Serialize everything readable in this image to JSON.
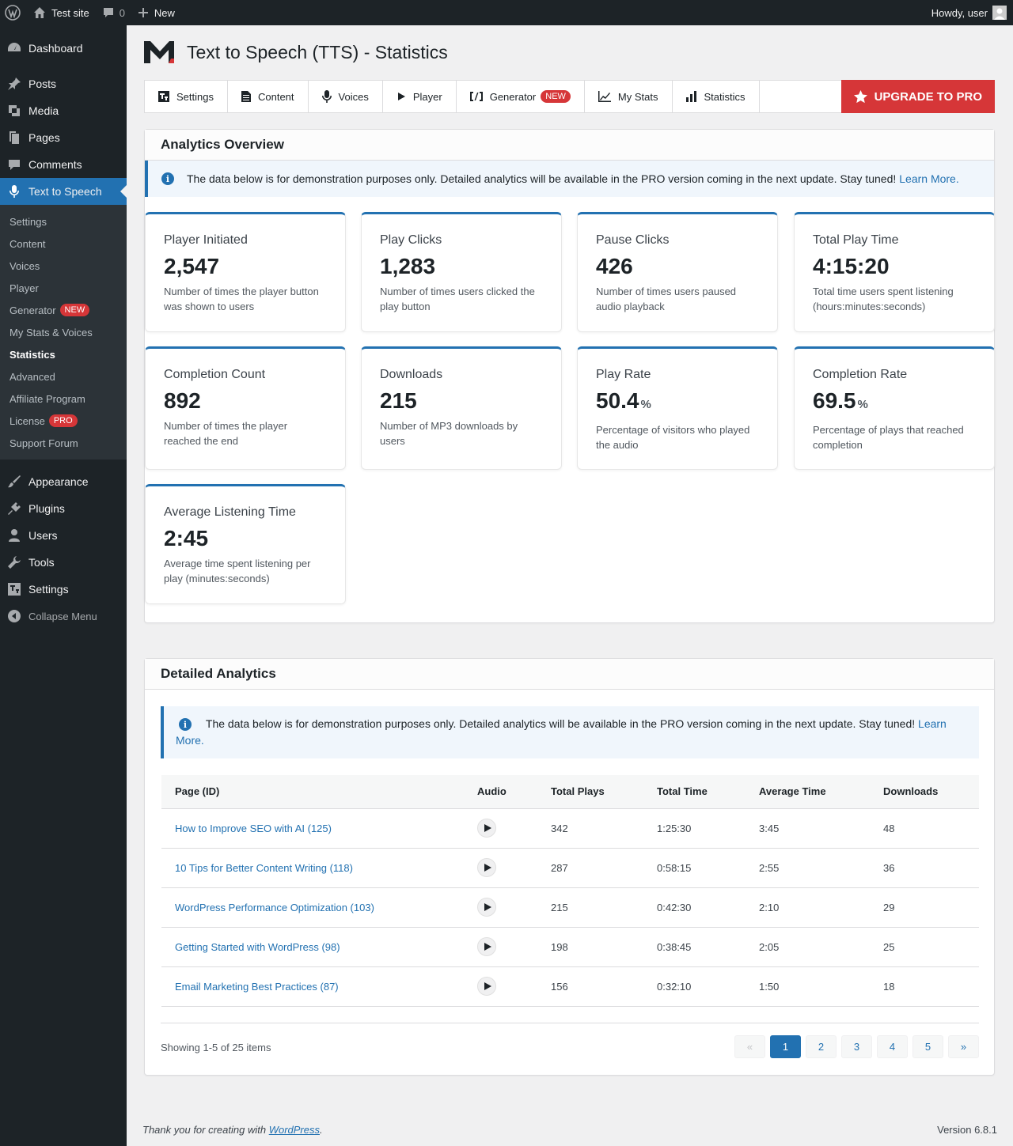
{
  "adminbar": {
    "site_name": "Test site",
    "comments_count": "0",
    "new_label": "New",
    "howdy": "Howdy, user"
  },
  "sidebar": {
    "items_top": [
      {
        "label": "Dashboard",
        "icon": "dashboard-icon"
      },
      {
        "label": "Posts",
        "icon": "pin-icon"
      },
      {
        "label": "Media",
        "icon": "media-icon"
      },
      {
        "label": "Pages",
        "icon": "pages-icon"
      },
      {
        "label": "Comments",
        "icon": "comment-icon"
      },
      {
        "label": "Text to Speech",
        "icon": "microphone-icon"
      }
    ],
    "submenu": [
      {
        "label": "Settings"
      },
      {
        "label": "Content"
      },
      {
        "label": "Voices"
      },
      {
        "label": "Player"
      },
      {
        "label": "Generator",
        "badge": "NEW"
      },
      {
        "label": "My Stats & Voices"
      },
      {
        "label": "Statistics"
      },
      {
        "label": "Advanced"
      },
      {
        "label": "Affiliate Program"
      },
      {
        "label": "License",
        "badge": "PRO"
      },
      {
        "label": "Support Forum"
      }
    ],
    "items_bottom": [
      {
        "label": "Appearance",
        "icon": "brush-icon"
      },
      {
        "label": "Plugins",
        "icon": "plugin-icon"
      },
      {
        "label": "Users",
        "icon": "user-icon"
      },
      {
        "label": "Tools",
        "icon": "wrench-icon"
      },
      {
        "label": "Settings",
        "icon": "settings-icon"
      }
    ],
    "collapse_label": "Collapse Menu"
  },
  "page": {
    "title": "Text to Speech (TTS) - Statistics"
  },
  "tabs": [
    {
      "label": "Settings",
      "icon": "settings-sliders-icon"
    },
    {
      "label": "Content",
      "icon": "document-icon"
    },
    {
      "label": "Voices",
      "icon": "microphone-icon"
    },
    {
      "label": "Player",
      "icon": "play-icon"
    },
    {
      "label": "Generator",
      "icon": "code-bracket-icon",
      "badge": "NEW"
    },
    {
      "label": "My Stats",
      "icon": "line-chart-icon"
    },
    {
      "label": "Statistics",
      "icon": "bar-chart-icon"
    }
  ],
  "upgrade_label": "UPGRADE TO PRO",
  "overview": {
    "title": "Analytics Overview",
    "notice_text": "The data below is for demonstration purposes only. Detailed analytics will be available in the PRO version coming in the next update. Stay tuned!",
    "notice_link": "Learn More.",
    "cards": [
      {
        "label": "Player Initiated",
        "value": "2,547",
        "unit": "",
        "desc": "Number of times the player button was shown to users"
      },
      {
        "label": "Play Clicks",
        "value": "1,283",
        "unit": "",
        "desc": "Number of times users clicked the play button"
      },
      {
        "label": "Pause Clicks",
        "value": "426",
        "unit": "",
        "desc": "Number of times users paused audio playback"
      },
      {
        "label": "Total Play Time",
        "value": "4:15:20",
        "unit": "",
        "desc": "Total time users spent listening (hours:minutes:seconds)"
      },
      {
        "label": "Completion Count",
        "value": "892",
        "unit": "",
        "desc": "Number of times the player reached the end"
      },
      {
        "label": "Downloads",
        "value": "215",
        "unit": "",
        "desc": "Number of MP3 downloads by users"
      },
      {
        "label": "Play Rate",
        "value": "50.4",
        "unit": "%",
        "desc": "Percentage of visitors who played the audio"
      },
      {
        "label": "Completion Rate",
        "value": "69.5",
        "unit": "%",
        "desc": "Percentage of plays that reached completion"
      },
      {
        "label": "Average Listening Time",
        "value": "2:45",
        "unit": "",
        "desc": "Average time spent listening per play (minutes:seconds)"
      }
    ]
  },
  "detailed": {
    "title": "Detailed Analytics",
    "notice_text": "The data below is for demonstration purposes only. Detailed analytics will be available in the PRO version coming in the next update. Stay tuned!",
    "notice_link": "Learn More.",
    "columns": [
      "Page (ID)",
      "Audio",
      "Total Plays",
      "Total Time",
      "Average Time",
      "Downloads"
    ],
    "rows": [
      {
        "page": "How to Improve SEO with AI (125)",
        "plays": "342",
        "total_time": "1:25:30",
        "avg_time": "3:45",
        "downloads": "48"
      },
      {
        "page": "10 Tips for Better Content Writing (118)",
        "plays": "287",
        "total_time": "0:58:15",
        "avg_time": "2:55",
        "downloads": "36"
      },
      {
        "page": "WordPress Performance Optimization (103)",
        "plays": "215",
        "total_time": "0:42:30",
        "avg_time": "2:10",
        "downloads": "29"
      },
      {
        "page": "Getting Started with WordPress (98)",
        "plays": "198",
        "total_time": "0:38:45",
        "avg_time": "2:05",
        "downloads": "25"
      },
      {
        "page": "Email Marketing Best Practices (87)",
        "plays": "156",
        "total_time": "0:32:10",
        "avg_time": "1:50",
        "downloads": "18"
      }
    ],
    "showing": "Showing 1-5 of 25 items",
    "pager": {
      "prev": "«",
      "pages": [
        "1",
        "2",
        "3",
        "4",
        "5"
      ],
      "next": "»",
      "current": "1"
    }
  },
  "footer": {
    "thanks_prefix": "Thank you for creating with",
    "wp_link": "WordPress",
    "thanks_suffix": ".",
    "version": "Version 6.8.1"
  }
}
